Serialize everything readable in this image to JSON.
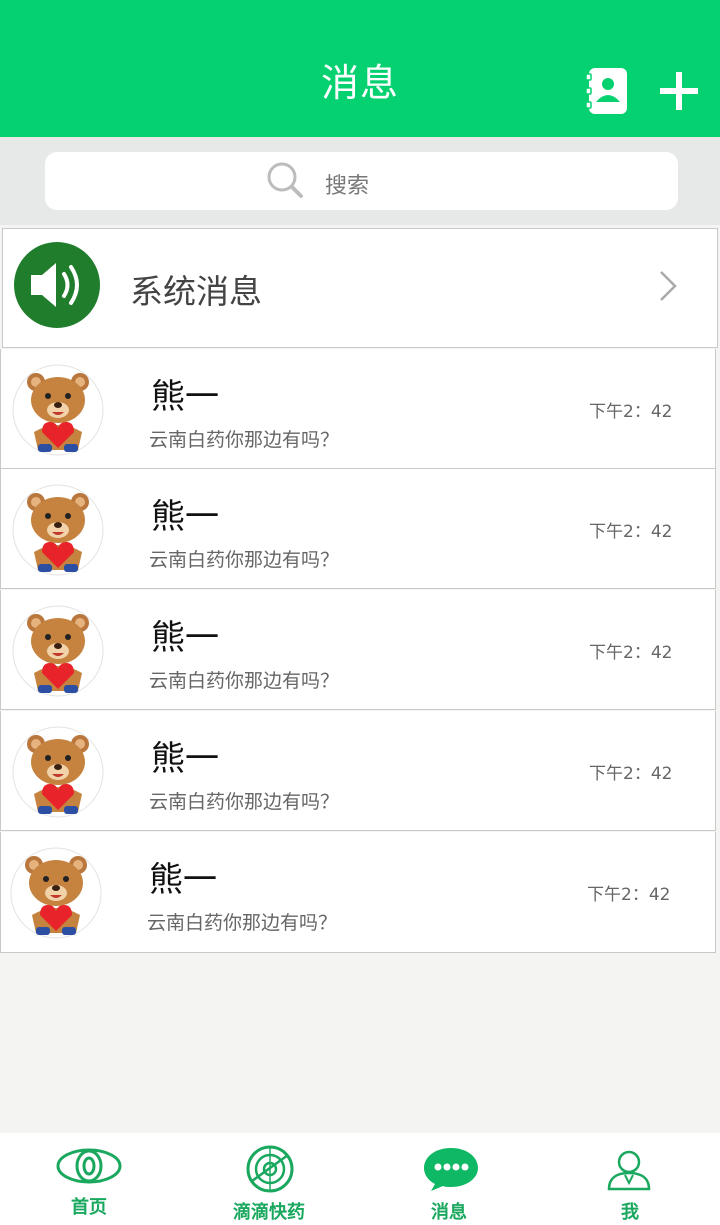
{
  "header": {
    "title": "消息"
  },
  "search": {
    "placeholder": "搜索"
  },
  "system": {
    "label": "系统消息"
  },
  "chats": [
    {
      "name": "熊一",
      "message": "云南白药你那边有吗？",
      "time": "下午2：42"
    },
    {
      "name": "熊一",
      "message": "云南白药你那边有吗？",
      "time": "下午2：42"
    },
    {
      "name": "熊一",
      "message": "云南白药你那边有吗？",
      "time": "下午2：42"
    },
    {
      "name": "熊一",
      "message": "云南白药你那边有吗？",
      "time": "下午2：42"
    },
    {
      "name": "熊一",
      "message": "云南白药你那边有吗？",
      "time": "下午2：42"
    }
  ],
  "tabs": [
    {
      "label": "首页",
      "icon": "eye-icon"
    },
    {
      "label": "滴滴快药",
      "icon": "radar-icon"
    },
    {
      "label": "消息",
      "icon": "chat-bubble-icon"
    },
    {
      "label": "我",
      "icon": "user-icon"
    }
  ],
  "colors": {
    "brand": "#05d170",
    "tab_active": "#1aa85f",
    "speaker_bg": "#1f7d2c"
  }
}
